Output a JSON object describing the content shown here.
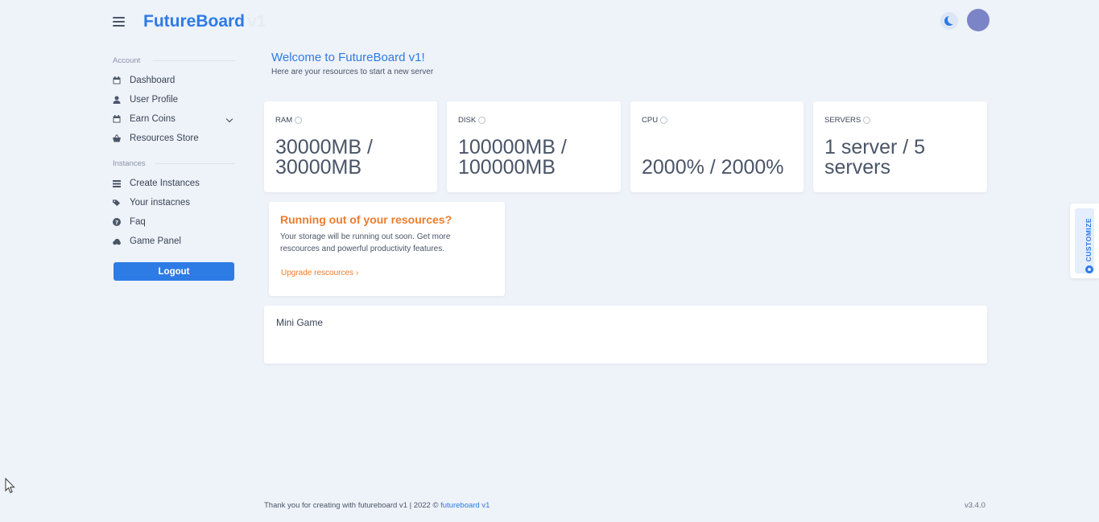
{
  "header": {
    "brand_main": "FutureBoard",
    "brand_suffix": "v1"
  },
  "sidebar": {
    "account_title": "Account",
    "account_items": [
      {
        "label": "Dashboard",
        "icon": "calendar-icon"
      },
      {
        "label": "User Profile",
        "icon": "user-icon"
      },
      {
        "label": "Earn Coins",
        "icon": "calendar-icon"
      },
      {
        "label": "Resources Store",
        "icon": "basket-icon"
      }
    ],
    "instances_title": "Instances",
    "instances_items": [
      {
        "label": "Create Instances",
        "icon": "list-icon"
      },
      {
        "label": "Your instacnes",
        "icon": "tags-icon"
      },
      {
        "label": "Faq",
        "icon": "question-icon"
      },
      {
        "label": "Game Panel",
        "icon": "cloud-icon"
      }
    ],
    "logout_label": "Logout"
  },
  "main": {
    "welcome_title": "Welcome to FutureBoard v1!",
    "welcome_subtitle": "Here are your resources to start a new server",
    "stats": [
      {
        "label": "RAM",
        "line1": "30000MB /",
        "line2": "30000MB"
      },
      {
        "label": "DISK",
        "line1": "100000MB /",
        "line2": "100000MB"
      },
      {
        "label": "CPU",
        "line1": "",
        "line2": "2000% / 2000%"
      },
      {
        "label": "SERVERS",
        "line1": "1 server / 5",
        "line2": "servers"
      }
    ],
    "promo": {
      "title": "Running out of your resources?",
      "text": "Your storage will be running out soon. Get more rescources and powerful productivity features.",
      "link": "Upgrade rescources ›"
    },
    "mini_game_title": "Mini Game"
  },
  "customize_label": "CUSTOMIZE",
  "footer": {
    "text": "Thank you for creating with futureboard v1 | 2022 © ",
    "link": "futureboard v1",
    "version": "v3.4.0"
  },
  "colors": {
    "accent": "#2d7be5",
    "warning": "#ee7c2b",
    "background": "#eef2f9",
    "avatar": "#7b84c7"
  }
}
